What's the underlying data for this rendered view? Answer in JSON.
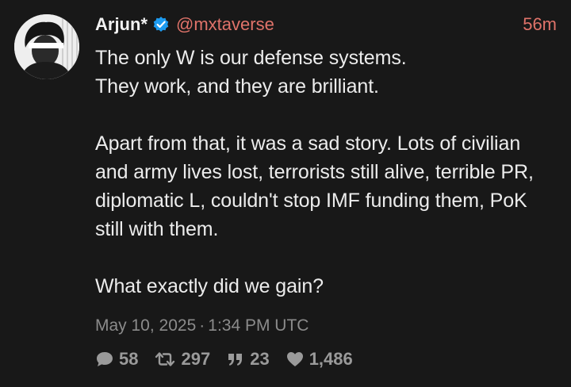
{
  "tweet": {
    "author": {
      "display_name": "Arjun*",
      "handle": "@mxtaverse",
      "verified_icon": "verified-badge-icon"
    },
    "time_ago": "56m",
    "text": "The only W is our defense systems.\nThey work, and they are brilliant.\n\nApart from that, it was a sad story. Lots of civilian and army lives lost, terrorists still alive, terrible PR, diplomatic L, couldn't stop IMF funding them, PoK still with them.\n\nWhat exactly did we gain?",
    "date": "May 10, 2025",
    "separator": "·",
    "time": "1:34 PM UTC",
    "stats": {
      "replies": "58",
      "retweets": "297",
      "quotes": "23",
      "likes": "1,486"
    }
  },
  "colors": {
    "background": "#181818",
    "accent": "#e0736a",
    "verified": "#1d9bf0",
    "muted": "#8b8b8b"
  }
}
